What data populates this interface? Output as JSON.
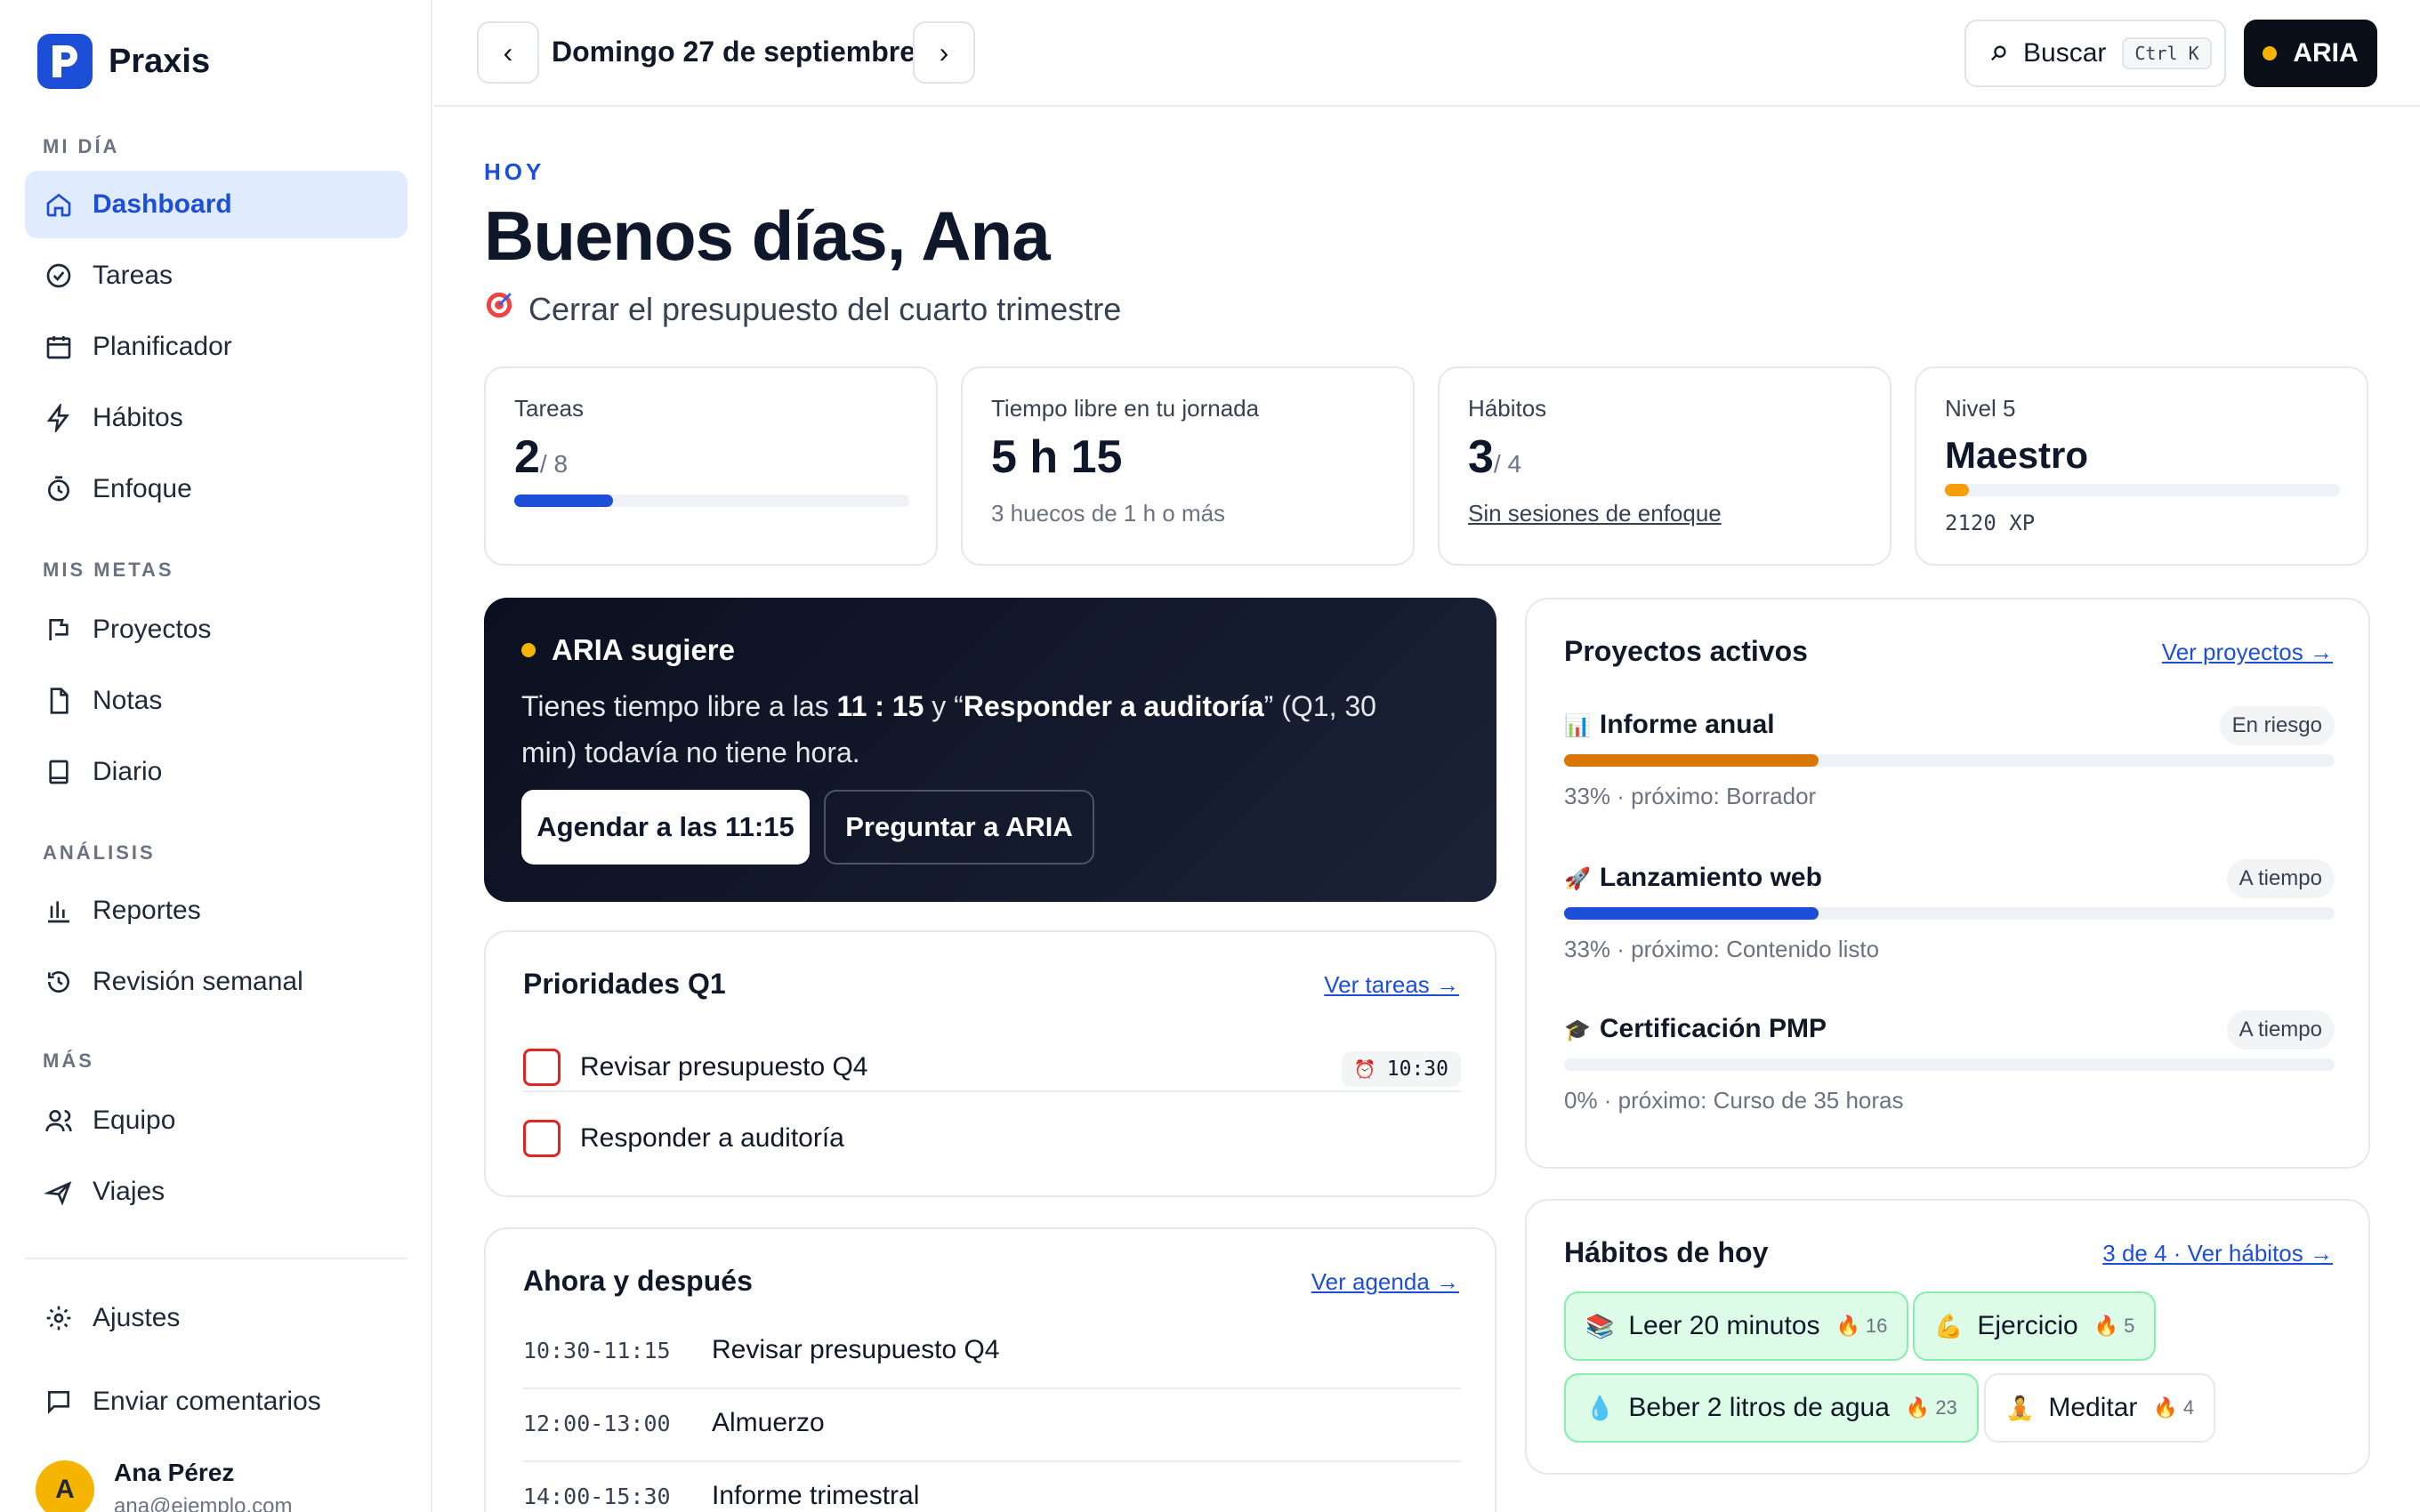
{
  "app": {
    "name": "Praxis",
    "logo_letter": "P"
  },
  "sidebar": {
    "sections": [
      {
        "label": "MI DÍA"
      },
      {
        "label": "MIS METAS"
      },
      {
        "label": "ANÁLISIS"
      },
      {
        "label": "MÁS"
      }
    ],
    "items": [
      {
        "label": "Dashboard",
        "icon": "home-icon"
      },
      {
        "label": "Tareas",
        "icon": "check-circle-icon"
      },
      {
        "label": "Planificador",
        "icon": "calendar-icon"
      },
      {
        "label": "Hábitos",
        "icon": "bolt-icon"
      },
      {
        "label": "Enfoque",
        "icon": "timer-icon"
      },
      {
        "label": "Proyectos",
        "icon": "flag-icon"
      },
      {
        "label": "Notas",
        "icon": "document-icon"
      },
      {
        "label": "Diario",
        "icon": "book-icon"
      },
      {
        "label": "Reportes",
        "icon": "bar-chart-icon"
      },
      {
        "label": "Revisión semanal",
        "icon": "history-icon"
      },
      {
        "label": "Equipo",
        "icon": "users-icon"
      },
      {
        "label": "Viajes",
        "icon": "plane-icon"
      },
      {
        "label": "Ajustes",
        "icon": "gear-icon"
      },
      {
        "label": "Enviar comentarios",
        "icon": "chat-icon"
      }
    ],
    "user": {
      "initial": "A",
      "name": "Ana Pérez",
      "email": "ana@ejemplo.com"
    }
  },
  "topbar": {
    "date": "Domingo 27 de septiembre",
    "prev": "‹",
    "next": "›",
    "search_label": "Buscar",
    "search_shortcut": "Ctrl K",
    "aria_label": "ARIA"
  },
  "header": {
    "eyebrow": "HOY",
    "greeting": "Buenos días, Ana",
    "goal": "Cerrar el presupuesto del cuarto trimestre"
  },
  "stats": {
    "tasks": {
      "label": "Tareas",
      "value": "2",
      "total": "/ 8",
      "progress": 0.25
    },
    "free_time": {
      "label": "Tiempo libre en tu jornada",
      "value": "5 h 15",
      "sub": "3 huecos de 1 h o más"
    },
    "habits": {
      "label": "Hábitos",
      "value": "3",
      "total": "/ 4",
      "link": "Sin sesiones de enfoque"
    },
    "level": {
      "label": "Nivel 5",
      "title": "Maestro",
      "progress": 0.06,
      "xp": "2120 XP"
    }
  },
  "aria_card": {
    "title": "ARIA sugiere",
    "text_1": "Tienes tiempo libre a las ",
    "time": "11 : 15",
    "text_2": " y “",
    "task": "Responder a auditoría",
    "text_3": "” (Q1, 30 min) todavía no tiene hora.",
    "primary": "Agendar a las 11:15",
    "secondary": "Preguntar a ARIA"
  },
  "priorities": {
    "title": "Prioridades Q1",
    "link": "Ver tareas →",
    "items": [
      {
        "label": "Revisar presupuesto Q4",
        "time": "10:30"
      },
      {
        "label": "Responder a auditoría"
      }
    ]
  },
  "schedule": {
    "title": "Ahora y después",
    "link": "Ver agenda →",
    "items": [
      {
        "time": "10:30-11:15",
        "label": "Revisar presupuesto Q4"
      },
      {
        "time": "12:00-13:00",
        "label": "Almuerzo"
      },
      {
        "time": "14:00-15:30",
        "label": "Informe trimestral"
      }
    ]
  },
  "projects": {
    "title": "Proyectos activos",
    "link": "Ver proyectos →",
    "items": [
      {
        "emoji": "📊",
        "name": "Informe anual",
        "status": "En riesgo",
        "progress": 0.33,
        "color": "#d97706",
        "sub": "33% · próximo: Borrador"
      },
      {
        "emoji": "🚀",
        "name": "Lanzamiento web",
        "status": "A tiempo",
        "progress": 0.33,
        "color": "#1d4ed8",
        "sub": "33% · próximo: Contenido listo"
      },
      {
        "emoji": "🎓",
        "name": "Certificación PMP",
        "status": "A tiempo",
        "progress": 0,
        "color": "#1d4ed8",
        "sub": "0% · próximo: Curso de 35 horas"
      }
    ]
  },
  "habits": {
    "title": "Hábitos de hoy",
    "link": "3 de 4 · Ver hábitos →",
    "items": [
      {
        "emoji": "📚",
        "name": "Leer 20 minutos",
        "streak": "16",
        "done": true
      },
      {
        "emoji": "💪",
        "name": "Ejercicio",
        "streak": "5",
        "done": true
      },
      {
        "emoji": "💧",
        "name": "Beber 2 litros de agua",
        "streak": "23",
        "done": true
      },
      {
        "emoji": "🧘",
        "name": "Meditar",
        "streak": "4",
        "done": false
      }
    ]
  },
  "colors": {
    "accent": "#1d4ed8",
    "dark": "#0b0f19",
    "amber": "#f5b400",
    "danger": "#dc2626",
    "success_bg": "#dcfce7"
  }
}
